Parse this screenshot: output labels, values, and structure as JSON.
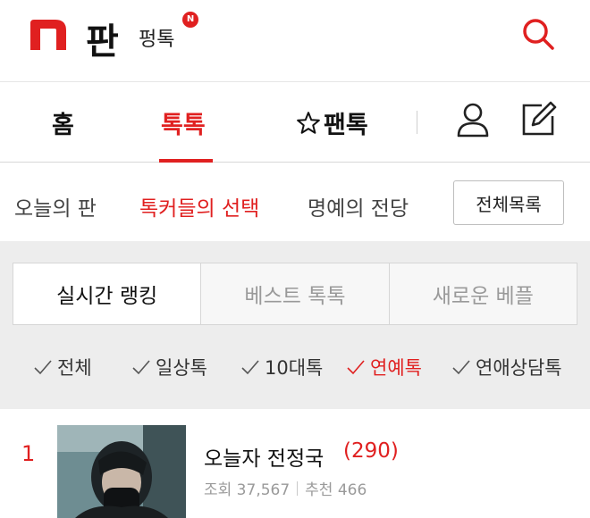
{
  "header": {
    "brand": "판",
    "sub_brand": "펑톡",
    "new_badge": "N",
    "accent_color": "#e02020"
  },
  "main_nav": {
    "home": "홈",
    "toktok": "톡톡",
    "pantok": "팬톡"
  },
  "sub_nav": {
    "today": "오늘의 판",
    "choice": "톡커들의 선택",
    "fame": "명예의 전당",
    "all_list": "전체목록"
  },
  "rank_tabs": [
    "실시간 랭킹",
    "베스트 톡톡",
    "새로운 베플"
  ],
  "filters": [
    {
      "label": "전체",
      "active": false
    },
    {
      "label": "일상톡",
      "active": false
    },
    {
      "label": "10대톡",
      "active": false
    },
    {
      "label": "연예톡",
      "active": true
    },
    {
      "label": "연애상담톡",
      "active": false
    }
  ],
  "list": [
    {
      "rank": "1",
      "title": "오늘자 전정국",
      "comment_count": "(290)",
      "views": "조회 37,567",
      "recommends": "추천 466"
    }
  ]
}
